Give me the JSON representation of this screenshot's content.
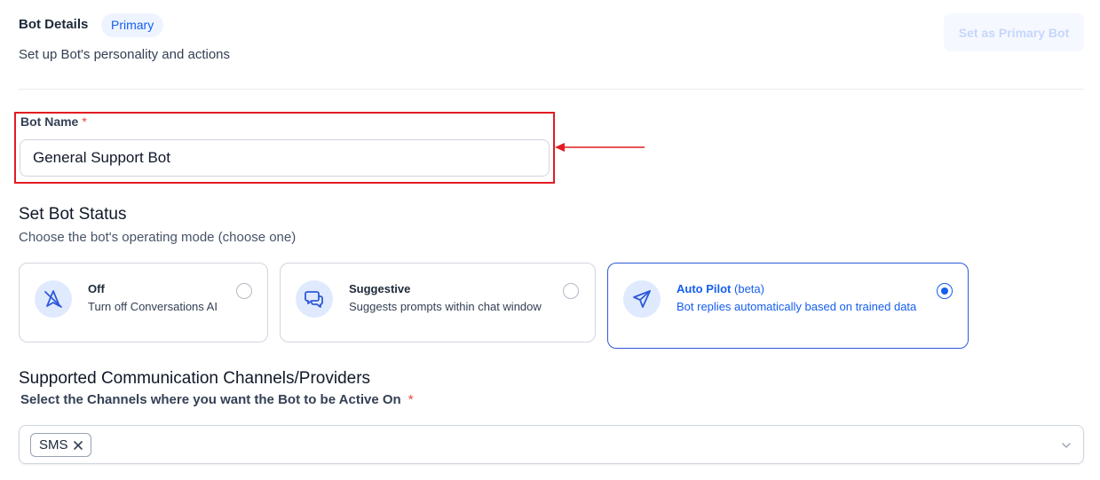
{
  "header": {
    "title": "Bot Details",
    "badge": "Primary",
    "subtitle": "Set up Bot's personality and actions",
    "set_primary_label": "Set as Primary Bot"
  },
  "bot_name": {
    "label": "Bot Name",
    "required_mark": "*",
    "value": "General Support Bot"
  },
  "status": {
    "title": "Set Bot Status",
    "subtitle": "Choose the bot's operating mode (choose one)",
    "options": [
      {
        "title": "Off",
        "beta": "",
        "description": "Turn off Conversations AI",
        "icon": "robot-off-icon",
        "selected": false
      },
      {
        "title": "Suggestive",
        "beta": "",
        "description": "Suggests prompts within chat window",
        "icon": "chat-bubbles-icon",
        "selected": false
      },
      {
        "title": "Auto Pilot",
        "beta": "(beta)",
        "description": "Bot replies automatically based on trained data",
        "icon": "paper-plane-icon",
        "selected": true
      }
    ]
  },
  "channels": {
    "title": "Supported Communication Channels/Providers",
    "label": "Select the Channels where you want the Bot to be Active On",
    "required_mark": "*",
    "selected": [
      "SMS"
    ]
  },
  "colors": {
    "accent": "#155eef",
    "highlight_box": "#e31b23",
    "icon_bg": "#e0eafe"
  }
}
